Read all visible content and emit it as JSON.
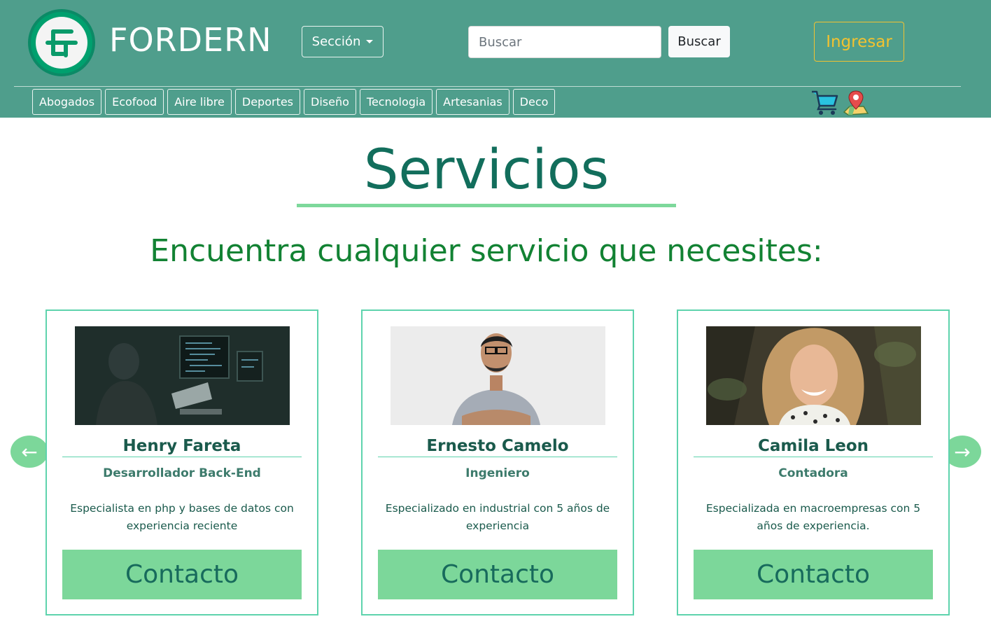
{
  "header": {
    "brand": "FORDERN",
    "section_dropdown": "Sección",
    "search_placeholder": "Buscar",
    "search_button": "Buscar",
    "login_button": "Ingresar",
    "categories": [
      "Abogados",
      "Ecofood",
      "Aire libre",
      "Deportes",
      "Diseño",
      "Tecnologia",
      "Artesanias",
      "Deco"
    ],
    "icons": [
      "cart-icon",
      "map-pin-icon"
    ]
  },
  "main": {
    "title": "Servicios",
    "subtitle": "Encuentra cualquier servicio que necesites:",
    "prev_arrow": "←",
    "next_arrow": "→",
    "cards": [
      {
        "name": "Henry Fareta",
        "role": "Desarrollador Back-End",
        "description": "Especialista en php y bases de datos con experiencia reciente",
        "button": "Contacto"
      },
      {
        "name": "Ernesto Camelo",
        "role": "Ingeniero",
        "description": "Especializado en industrial con 5 años de experiencia",
        "button": "Contacto"
      },
      {
        "name": "Camila Leon",
        "role": "Contadora",
        "description": "Especializada en macroempresas con 5 años de experiencia.",
        "button": "Contacto"
      }
    ]
  },
  "colors": {
    "header_bg": "#4f9e8c",
    "title": "#126e5c",
    "subtitle": "#128233",
    "accent_green": "#7cd79a",
    "card_border": "#5ed3ad",
    "login_yellow": "#f2c230"
  }
}
